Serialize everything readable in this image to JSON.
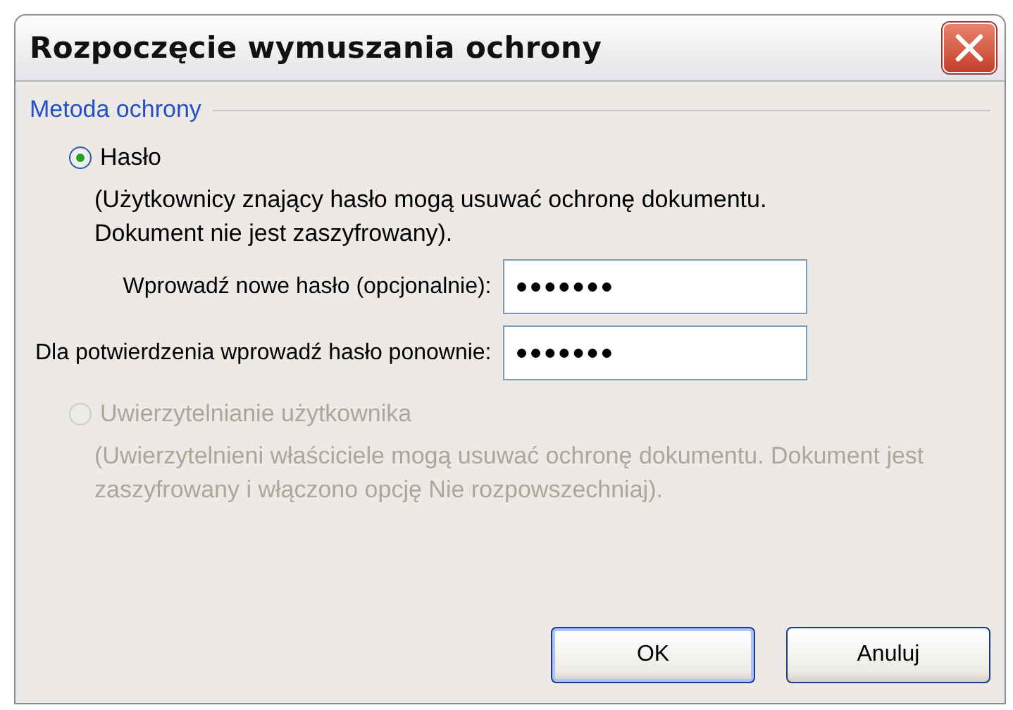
{
  "window": {
    "title": "Rozpoczęcie wymuszania ochrony"
  },
  "group": {
    "label": "Metoda ochrony"
  },
  "options": [
    {
      "label": "Hasło",
      "description": "(Użytkownicy znający hasło mogą usuwać ochronę dokumentu. Dokument nie jest zaszyfrowany).",
      "selected": true,
      "disabled": false,
      "fields": [
        {
          "label": "Wprowadź nowe hasło (opcjonalnie):",
          "value": "●●●●●●●"
        },
        {
          "label": "Dla potwierdzenia wprowadź hasło ponownie:",
          "value": "●●●●●●●"
        }
      ]
    },
    {
      "label": "Uwierzytelnianie użytkownika",
      "description": "(Uwierzytelnieni właściciele mogą usuwać ochronę dokumentu. Dokument jest zaszyfrowany i włączono opcję Nie rozpowszechniaj).",
      "selected": false,
      "disabled": true
    }
  ],
  "buttons": [
    {
      "label": "OK",
      "default": true
    },
    {
      "label": "Anuluj",
      "default": false
    }
  ]
}
